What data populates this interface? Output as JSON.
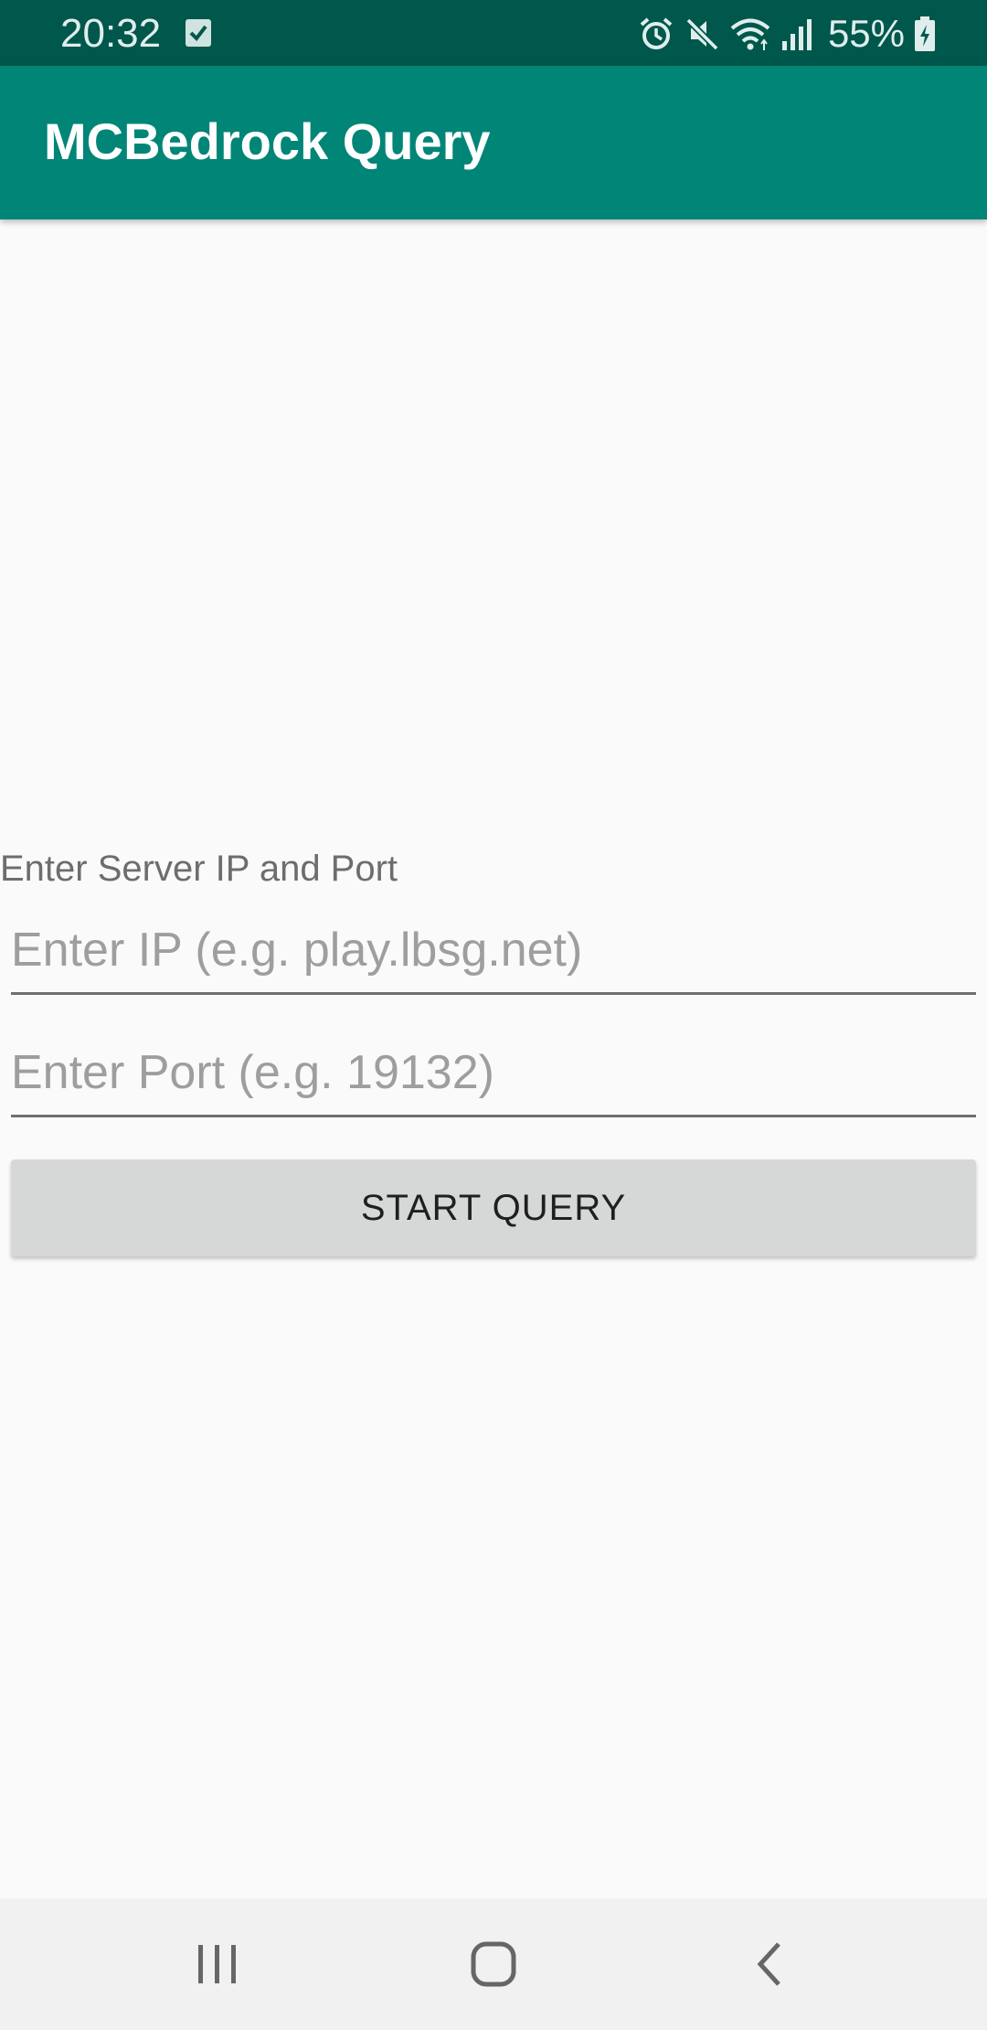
{
  "status_bar": {
    "time": "20:32",
    "battery": "55%",
    "icons": [
      "checkbox-notification-icon",
      "alarm-icon",
      "mute-icon",
      "wifi-icon",
      "signal-icon",
      "battery-charging-icon"
    ]
  },
  "app_bar": {
    "title": "MCBedrock Query",
    "color": "#008577",
    "status_color": "#00574b"
  },
  "form": {
    "label": "Enter Server IP and Port",
    "ip_placeholder": "Enter IP (e.g. play.lbsg.net)",
    "ip_value": "",
    "port_placeholder": "Enter Port (e.g. 19132)",
    "port_value": "",
    "button_label": "START QUERY"
  },
  "nav_bar": {
    "icons": [
      "recents-icon",
      "home-icon",
      "back-icon"
    ]
  }
}
